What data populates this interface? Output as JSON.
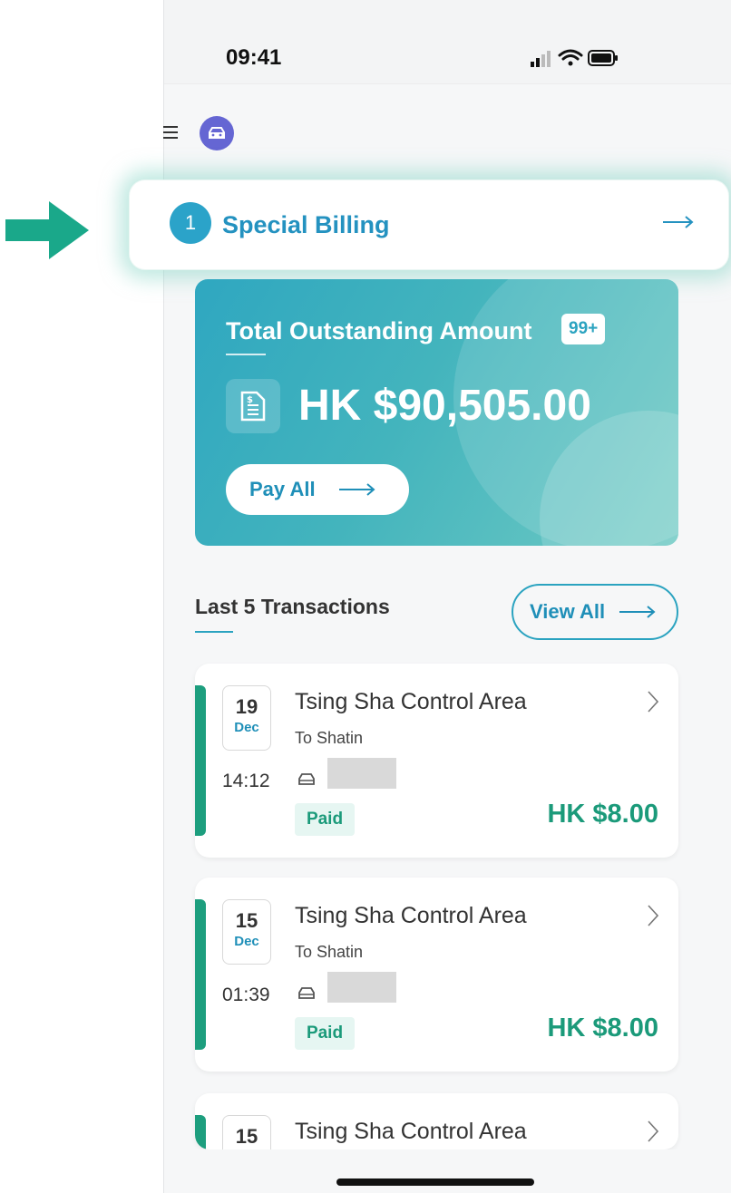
{
  "status_bar": {
    "time": "09:41",
    "icons": [
      "signal-icon",
      "wifi-icon",
      "battery-icon"
    ]
  },
  "header": {
    "menu_icon": "hamburger-icon",
    "avatar_icon": "car-icon"
  },
  "special_billing": {
    "number": "1",
    "title": "Special Billing",
    "arrow_icon": "arrow-right-icon"
  },
  "outstanding": {
    "title": "Total Outstanding Amount",
    "badge": "99+",
    "amount": "HK $90,505.00",
    "pay_all_label": "Pay All"
  },
  "transactions": {
    "title": "Last 5 Transactions",
    "view_all_label": "View All",
    "items": [
      {
        "day": "19",
        "month": "Dec",
        "time": "14:12",
        "place": "Tsing Sha Control Area",
        "direction": "To Shatin",
        "status": "Paid",
        "amount": "HK $8.00"
      },
      {
        "day": "15",
        "month": "Dec",
        "time": "01:39",
        "place": "Tsing Sha Control Area",
        "direction": "To Shatin",
        "status": "Paid",
        "amount": "HK $8.00"
      },
      {
        "day": "15",
        "place": "Tsing Sha Control Area"
      }
    ]
  },
  "colors": {
    "accent_blue": "#2ba3c9",
    "title_blue": "#2492c0",
    "green": "#1d9e7e",
    "avatar": "#6566d3",
    "annotation_arrow": "#1aa88a"
  }
}
